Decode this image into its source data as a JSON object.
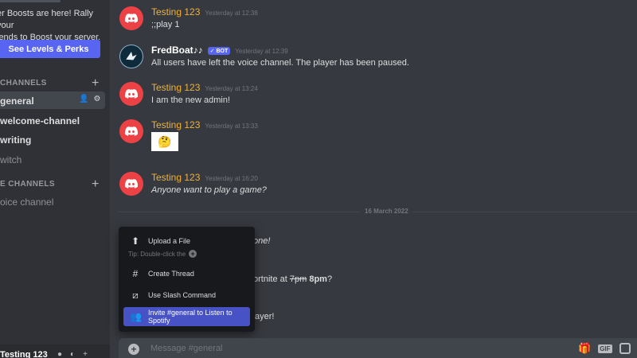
{
  "sidebar": {
    "boost_text_line1": "er Boosts are here! Rally your",
    "boost_text_line2": "iends to Boost your server.",
    "boost_button": "See Levels & Perks",
    "text_category": "CHANNELS",
    "voice_category": "E CHANNELS",
    "channels": [
      "general",
      "welcome-channel",
      "writing",
      "witch"
    ],
    "voice_channel": "oice channel",
    "user_name": "Testing 123"
  },
  "messages": [
    {
      "author": "Testing 123",
      "timestamp": "Yesterday at 12:38",
      "text": ";;play 1"
    },
    {
      "author": "FredBoat♪♪",
      "bot_tag": "✓ BOT",
      "timestamp": "Yesterday at 12:39",
      "text": "All users have left the voice channel. The player has been paused."
    },
    {
      "author": "Testing 123",
      "timestamp": "Yesterday at 13:24",
      "text": "I am the new admin!"
    },
    {
      "author": "Testing 123",
      "timestamp": "Yesterday at 13:33",
      "emoji": "🤔"
    },
    {
      "author": "Testing 123",
      "timestamp": "Yesterday at 16:20",
      "text": "Anyone want to play a game?"
    }
  ],
  "date_divider": "16 March 2022",
  "partials": {
    "line1": "one!",
    "line2_prefix": "ortnite at ",
    "line2_strike": "7pm",
    "line2_bold": "8pm",
    "line2_suffix": "?",
    "line3": "ayer!"
  },
  "popup": {
    "upload": "Upload a File",
    "tip": "Tip: Double-click the",
    "thread": "Create Thread",
    "slash": "Use Slash Command",
    "spotify": "Invite #general to Listen to Spotify"
  },
  "input": {
    "placeholder": "Message #general",
    "gif_label": "GIF"
  },
  "colors": {
    "accent": "#5865f2",
    "author": "#f0b232",
    "avatar": "#ed4245"
  },
  "icons": {
    "upload": "upload-icon",
    "thread": "thread-icon",
    "slash": "slash-command-icon",
    "spotify": "spotify-invite-icon"
  }
}
